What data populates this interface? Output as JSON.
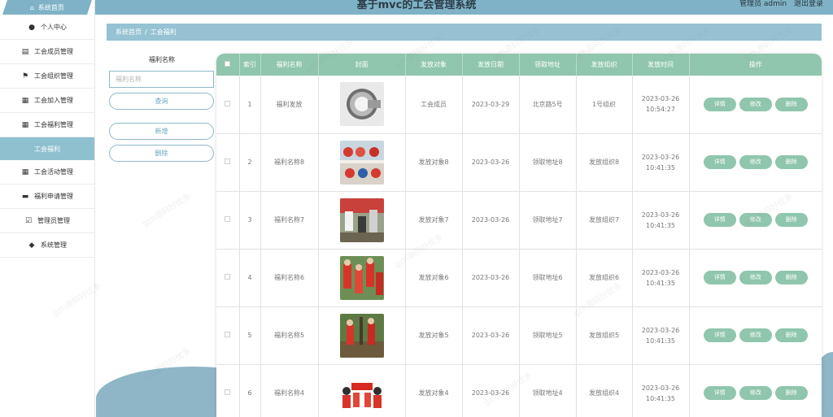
{
  "header": {
    "title": "基于mvc的工会管理系统",
    "user_label": "管理员 admin",
    "logout_label": "退出登录"
  },
  "sidebar": {
    "home_label": "系统首页",
    "items": [
      {
        "label": "个人中心",
        "icon": "person-icon"
      },
      {
        "label": "工会成员管理",
        "icon": "clipboard-icon"
      },
      {
        "label": "工会组织管理",
        "icon": "flag-icon"
      },
      {
        "label": "工会加入管理",
        "icon": "grid-icon"
      },
      {
        "label": "工会福利管理",
        "icon": "grid-icon"
      },
      {
        "label": "工会福利",
        "icon": "",
        "active": true
      },
      {
        "label": "工会活动管理",
        "icon": "grid-icon"
      },
      {
        "label": "福利申请管理",
        "icon": "monitor-icon"
      },
      {
        "label": "管理员管理",
        "icon": "clipboard-check-icon"
      },
      {
        "label": "系统管理",
        "icon": "gamepad-icon"
      }
    ]
  },
  "breadcrumb": {
    "home": "系统首页",
    "separator": "/",
    "current": "工会福利"
  },
  "filter": {
    "label": "福利名称",
    "placeholder": "福利名称",
    "search_label": "查询",
    "add_label": "新增",
    "delete_label": "删除"
  },
  "table": {
    "headers": [
      "索引",
      "福利名称",
      "封面",
      "发放对象",
      "发放日期",
      "领取地址",
      "发放组织",
      "发放时间",
      "操作"
    ],
    "action_labels": {
      "detail": "详情",
      "edit": "修改",
      "delete": "删除"
    },
    "rows": [
      {
        "index": "1",
        "name": "福利发放",
        "target": "工会成员",
        "date": "2023-03-29",
        "address": "北京路5号",
        "org": "1号组织",
        "time": "2023-03-26 10:54:27",
        "cover": "tape-roll"
      },
      {
        "index": "2",
        "name": "福利名称8",
        "target": "发放对象8",
        "date": "2023-03-26",
        "address": "领取地址8",
        "org": "发放组织8",
        "time": "2023-03-26 10:41:35",
        "cover": "volunteers-group"
      },
      {
        "index": "3",
        "name": "福利名称7",
        "target": "发放对象7",
        "date": "2023-03-26",
        "address": "领取地址7",
        "org": "发放组织7",
        "time": "2023-03-26 10:41:35",
        "cover": "volunteers-work"
      },
      {
        "index": "4",
        "name": "福利名称6",
        "target": "发放对象6",
        "date": "2023-03-26",
        "address": "领取地址6",
        "org": "发放组织6",
        "time": "2023-03-26 10:41:35",
        "cover": "volunteers-red"
      },
      {
        "index": "5",
        "name": "福利名称5",
        "target": "发放对象5",
        "date": "2023-03-26",
        "address": "领取地址5",
        "org": "发放组织5",
        "time": "2023-03-26 10:41:35",
        "cover": "tree-planting"
      },
      {
        "index": "6",
        "name": "福利名称4",
        "target": "发放对象4",
        "date": "2023-03-26",
        "address": "领取地址4",
        "org": "发放组织4",
        "time": "2023-03-26 10:41:35",
        "cover": "banner-group"
      }
    ]
  },
  "watermark": "gzh源码好优多",
  "colors": {
    "primary": "#7fb2c6",
    "accent": "#8fc6ad",
    "breadcrumb": "#96c2d3"
  }
}
